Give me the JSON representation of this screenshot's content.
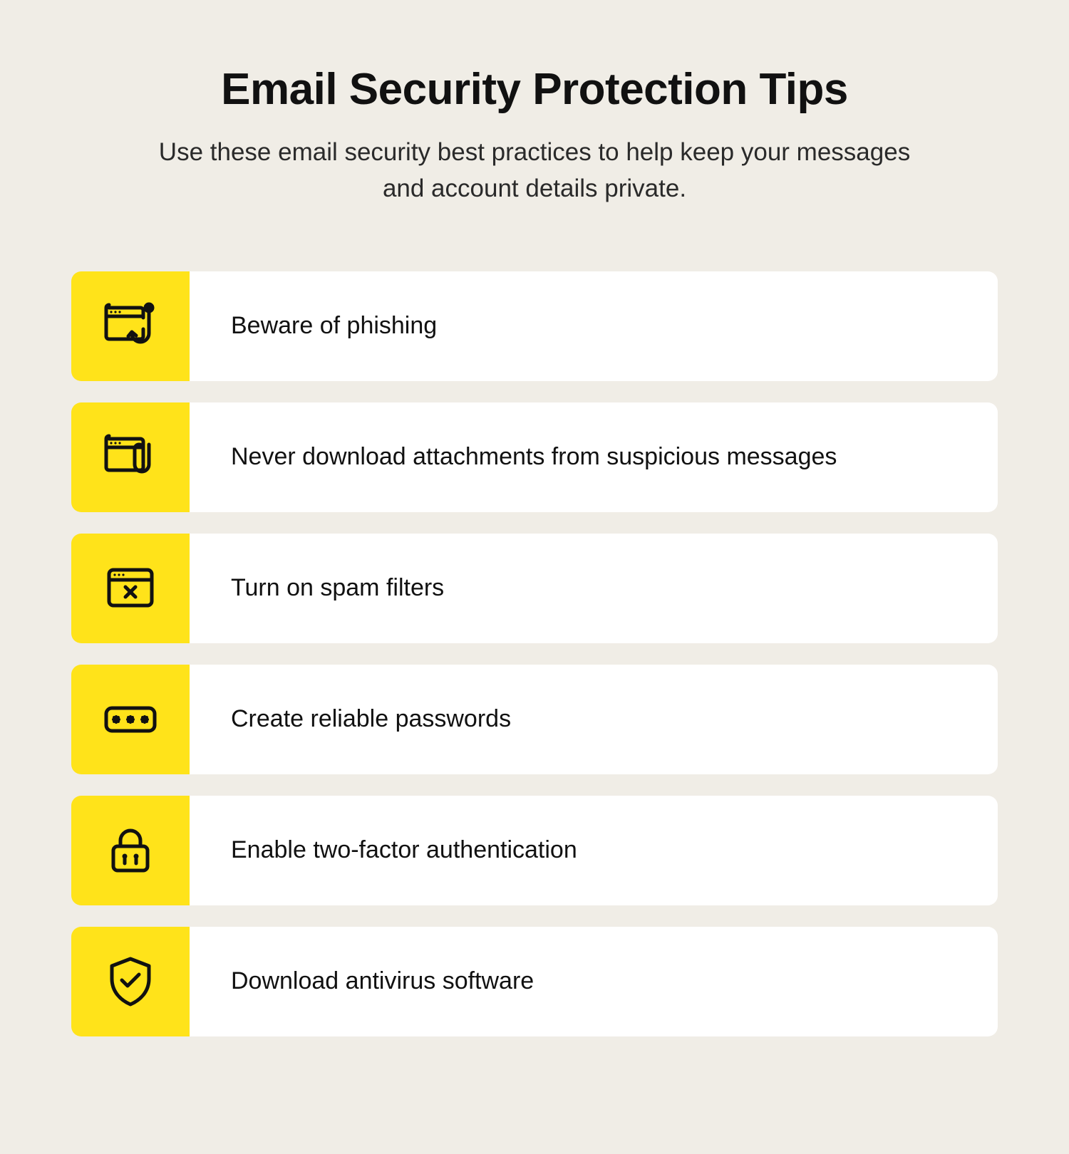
{
  "header": {
    "title": "Email Security Protection Tips",
    "subtitle": "Use these email security best practices to help keep your messages and account details private."
  },
  "tips": [
    {
      "icon": "phishing-hook-icon",
      "label": "Beware of phishing"
    },
    {
      "icon": "attachment-window-icon",
      "label": "Never download attachments from suspicious messages"
    },
    {
      "icon": "spam-window-icon",
      "label": "Turn on spam filters"
    },
    {
      "icon": "password-field-icon",
      "label": "Create reliable passwords"
    },
    {
      "icon": "lock-2fa-icon",
      "label": "Enable two-factor authentication"
    },
    {
      "icon": "shield-check-icon",
      "label": "Download antivirus software"
    }
  ],
  "colors": {
    "accent": "#ffe31a",
    "card": "#ffffff",
    "page": "#f0ede6",
    "text": "#111111"
  }
}
